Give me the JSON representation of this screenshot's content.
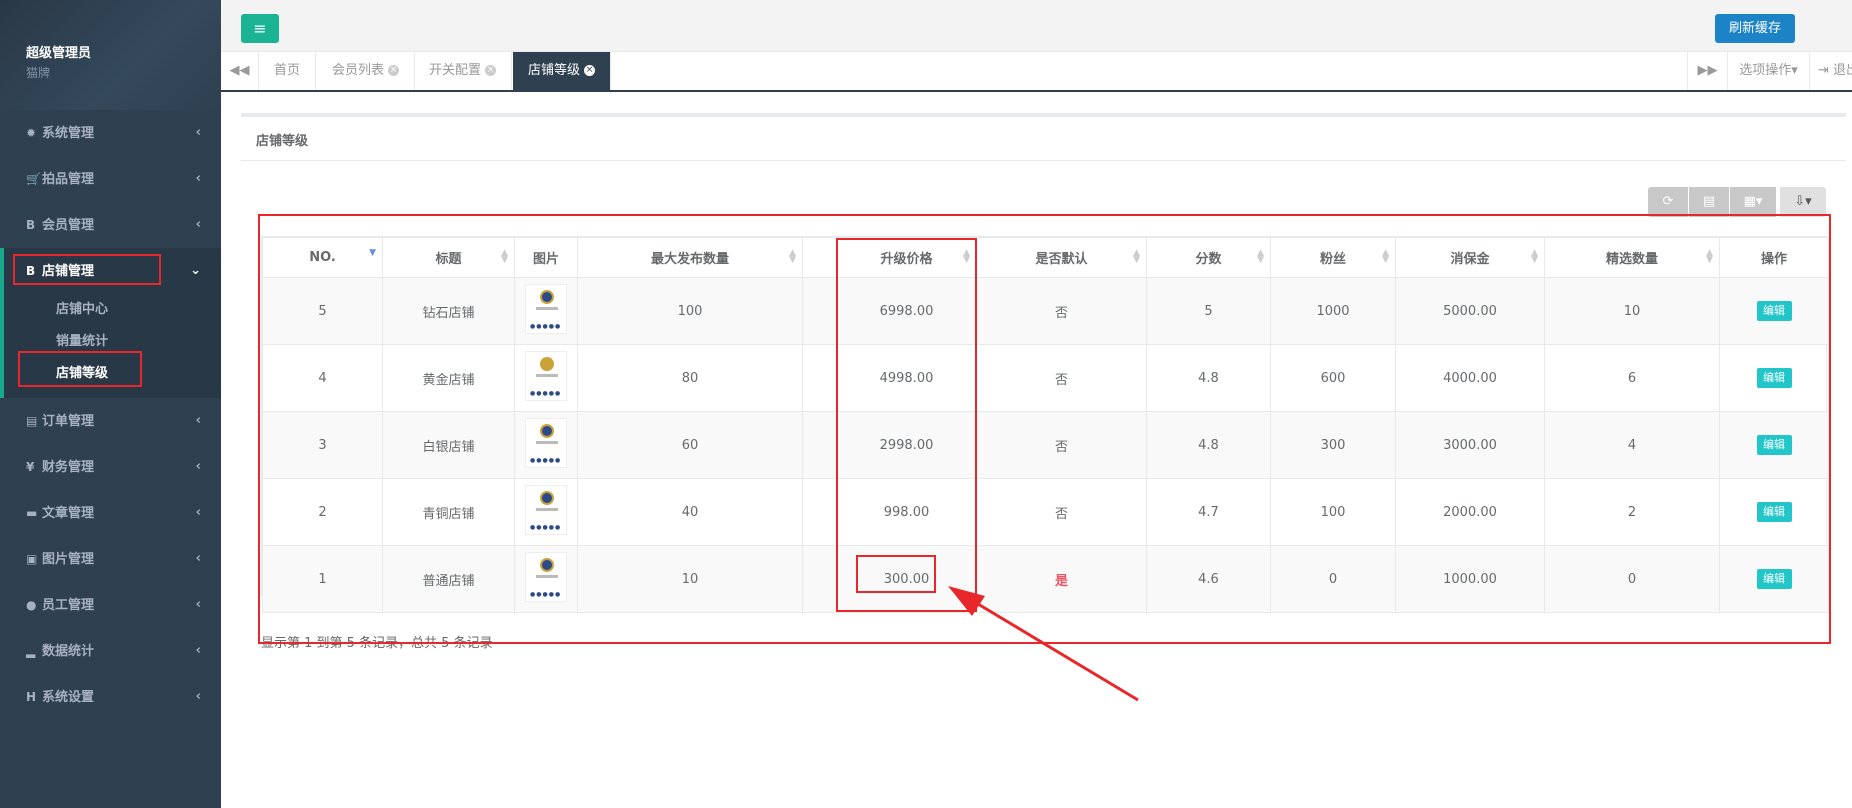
{
  "sidebar": {
    "profile_name": "超级管理员",
    "profile_role": "猫牌",
    "items": [
      {
        "label": "系统管理",
        "icon": "gear-icon"
      },
      {
        "label": "拍品管理",
        "icon": "cart-icon"
      },
      {
        "label": "会员管理",
        "icon": "b-icon"
      },
      {
        "label": "店铺管理",
        "icon": "b-icon"
      },
      {
        "label": "订单管理",
        "icon": "list-icon"
      },
      {
        "label": "财务管理",
        "icon": "yen-icon"
      },
      {
        "label": "文章管理",
        "icon": "briefcase-icon"
      },
      {
        "label": "图片管理",
        "icon": "image-icon"
      },
      {
        "label": "员工管理",
        "icon": "user-icon"
      },
      {
        "label": "数据统计",
        "icon": "bar-chart-icon"
      },
      {
        "label": "系统设置",
        "icon": "h-icon"
      }
    ],
    "sub_items": [
      "店铺中心",
      "销量统计",
      "店铺等级"
    ]
  },
  "topbar": {
    "refresh_label": "刷新缓存"
  },
  "tabs": [
    {
      "label": "首页"
    },
    {
      "label": "会员列表"
    },
    {
      "label": "开关配置"
    },
    {
      "label": "店铺等级"
    }
  ],
  "tabbar": {
    "options_label": "选项操作",
    "exit_label": "退出"
  },
  "panel": {
    "title": "店铺等级",
    "summary": "显示第 1 到第 5 条记录，总共 5 条记录"
  },
  "table": {
    "headers": [
      "NO.",
      "标题",
      "图片",
      "最大发布数量",
      "",
      "升级价格",
      "是否默认",
      "分数",
      "粉丝",
      "消保金",
      "精选数量",
      "操作"
    ],
    "rows": [
      {
        "no": "5",
        "title": "钻石店铺",
        "max": "100",
        "price": "6998.00",
        "default": "否",
        "score": "5",
        "fans": "1000",
        "deposit": "5000.00",
        "featured": "10",
        "action": "编辑"
      },
      {
        "no": "4",
        "title": "黄金店铺",
        "max": "80",
        "price": "4998.00",
        "default": "否",
        "score": "4.8",
        "fans": "600",
        "deposit": "4000.00",
        "featured": "6",
        "action": "编辑"
      },
      {
        "no": "3",
        "title": "白银店铺",
        "max": "60",
        "price": "2998.00",
        "default": "否",
        "score": "4.8",
        "fans": "300",
        "deposit": "3000.00",
        "featured": "4",
        "action": "编辑"
      },
      {
        "no": "2",
        "title": "青铜店铺",
        "max": "40",
        "price": "998.00",
        "default": "否",
        "score": "4.7",
        "fans": "100",
        "deposit": "2000.00",
        "featured": "2",
        "action": "编辑"
      },
      {
        "no": "1",
        "title": "普通店铺",
        "max": "10",
        "price": "300.00",
        "default": "是",
        "score": "4.6",
        "fans": "0",
        "deposit": "1000.00",
        "featured": "0",
        "action": "编辑"
      }
    ]
  },
  "colors": {
    "sidebar_bg": "#2f4050",
    "accent_green": "#1ab394",
    "refresh_blue": "#1c84c6",
    "edit_cyan": "#23c6c8",
    "annotation_red": "#e8272a"
  }
}
